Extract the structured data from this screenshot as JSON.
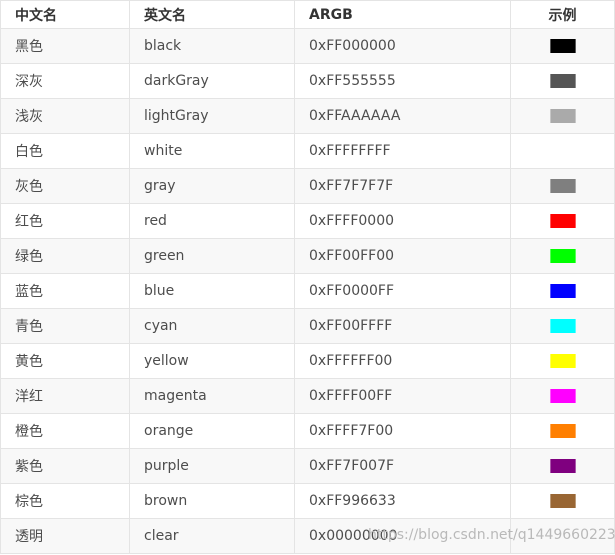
{
  "table": {
    "headers": [
      "中文名",
      "英文名",
      "ARGB",
      "示例"
    ],
    "rows": [
      {
        "cn": "黑色",
        "en": "black",
        "argb": "0xFF000000",
        "hex": "#000000"
      },
      {
        "cn": "深灰",
        "en": "darkGray",
        "argb": "0xFF555555",
        "hex": "#555555"
      },
      {
        "cn": "浅灰",
        "en": "lightGray",
        "argb": "0xFFAAAAAA",
        "hex": "#AAAAAA"
      },
      {
        "cn": "白色",
        "en": "white",
        "argb": "0xFFFFFFFF",
        "hex": "#FFFFFF"
      },
      {
        "cn": "灰色",
        "en": "gray",
        "argb": "0xFF7F7F7F",
        "hex": "#7F7F7F"
      },
      {
        "cn": "红色",
        "en": "red",
        "argb": "0xFFFF0000",
        "hex": "#FF0000"
      },
      {
        "cn": "绿色",
        "en": "green",
        "argb": "0xFF00FF00",
        "hex": "#00FF00"
      },
      {
        "cn": "蓝色",
        "en": "blue",
        "argb": "0xFF0000FF",
        "hex": "#0000FF"
      },
      {
        "cn": "青色",
        "en": "cyan",
        "argb": "0xFF00FFFF",
        "hex": "#00FFFF"
      },
      {
        "cn": "黄色",
        "en": "yellow",
        "argb": "0xFFFFFF00",
        "hex": "#FFFF00"
      },
      {
        "cn": "洋红",
        "en": "magenta",
        "argb": "0xFFFF00FF",
        "hex": "#FF00FF"
      },
      {
        "cn": "橙色",
        "en": "orange",
        "argb": "0xFFFF7F00",
        "hex": "#FF7F00"
      },
      {
        "cn": "紫色",
        "en": "purple",
        "argb": "0xFF7F007F",
        "hex": "#7F007F"
      },
      {
        "cn": "棕色",
        "en": "brown",
        "argb": "0xFF996633",
        "hex": "#996633"
      },
      {
        "cn": "透明",
        "en": "clear",
        "argb": "0x00000000",
        "hex": ""
      }
    ]
  },
  "watermark": "https://blog.csdn.net/q1449660223"
}
